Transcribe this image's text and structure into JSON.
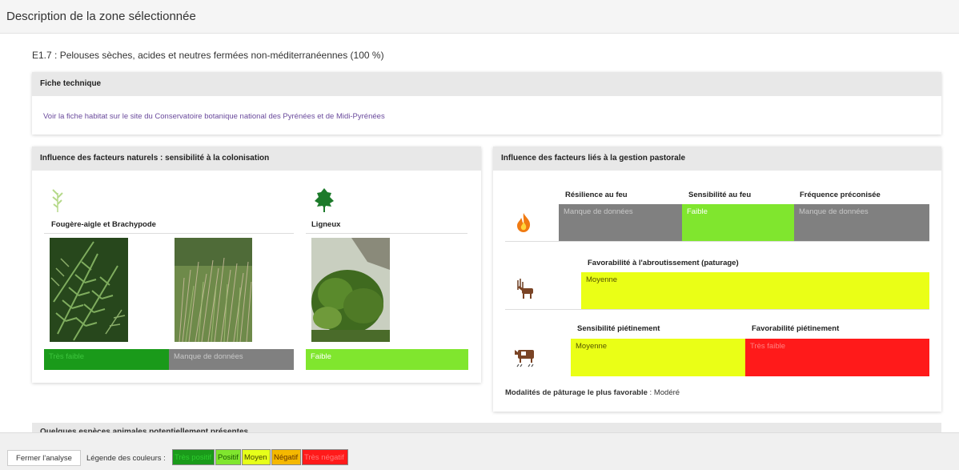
{
  "header": {
    "title": "Description de la zone sélectionnée"
  },
  "habitat": {
    "line": "E1.7 : Pelouses sèches, acides et neutres fermées non-méditerranéennes (100 %)"
  },
  "fiche": {
    "title": "Fiche technique",
    "link": "Voir la fiche habitat sur le site du Conservatoire botanique national des Pyrénées et de Midi-Pyrénées"
  },
  "naturels": {
    "title": "Influence des facteurs naturels : sensibilité à la colonisation",
    "group1_label": "Fougère-aigle et Brachypode",
    "group2_label": "Ligneux",
    "cell1": "Très faible",
    "cell2": "Manque de données",
    "cell3": "Faible"
  },
  "pastorale": {
    "title": "Influence des facteurs liés à la gestion pastorale",
    "fire": {
      "col1": "Résilience au feu",
      "col2": "Sensibilité au feu",
      "col3": "Fréquence préconisée",
      "val1": "Manque de données",
      "val2": "Faible",
      "val3": "Manque de données"
    },
    "grazing": {
      "col1": "Favorabilité à l'abroutissement (paturage)",
      "val1": "Moyenne"
    },
    "trampling": {
      "col1": "Sensibilité piétinement",
      "col2": "Favorabilité piétinement",
      "val1": "Moyenne",
      "val2": "Très faible"
    },
    "modalites_label": "Modalités de pâturage le plus favorable",
    "modalites_value": "Modéré"
  },
  "next_panel": {
    "title": "Quelques espèces animales potentiellement présentes"
  },
  "footer": {
    "close_button": "Fermer l'analyse",
    "legend_label": "Légende des couleurs :",
    "legend": [
      {
        "label": "Très positif",
        "color": "#1a9a1a",
        "text_color": "#2ecc2e"
      },
      {
        "label": "Positif",
        "color": "#80e62e",
        "text_color": "#1a5a00"
      },
      {
        "label": "Moyen",
        "color": "#e6ff1a",
        "text_color": "#444400"
      },
      {
        "label": "Négatif",
        "color": "#f5b800",
        "text_color": "#663300"
      },
      {
        "label": "Très négatif",
        "color": "#ff1a1a",
        "text_color": "#ff7a7a"
      }
    ]
  },
  "colors": {
    "very_positive": "#1a9a1a",
    "positive": "#80e62e",
    "medium": "#e6ff1a",
    "negative": "#f5b800",
    "very_negative": "#ff1a1a",
    "no_data": "#808080"
  }
}
